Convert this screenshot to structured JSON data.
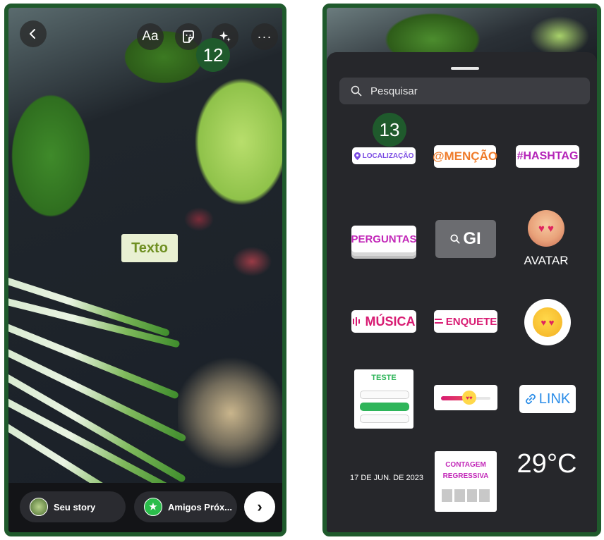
{
  "left_screen": {
    "text_sticker": "Texto",
    "toolbar": {
      "text_tool_label": "Aa",
      "more_label": "···"
    },
    "step_badge": "12",
    "bottom_bar": {
      "your_story_label": "Seu story",
      "close_friends_label": "Amigos Próx...",
      "next_label": "›"
    }
  },
  "right_screen": {
    "step_badge": "13",
    "search": {
      "placeholder": "Pesquisar"
    },
    "stickers": {
      "location": "LOCALIZAÇÃO",
      "mention": "@MENÇÃO",
      "hashtag": "#HASHTAG",
      "questions": "PERGUNTAS",
      "gif": "GI",
      "avatar": "AVATAR",
      "music": "MÚSICA",
      "poll": "ENQUETE",
      "quiz": "TESTE",
      "link": "LINK",
      "date": "17 DE JUN. DE 2023",
      "countdown": "CONTAGEM\nREGRESSIVA",
      "temperature": "29°C"
    },
    "quiz_selected_index": 1
  },
  "colors": {
    "frame_border": "#1f5a2c",
    "badge": "#1f5a2c",
    "tray": "#26272b"
  },
  "icons": [
    "back-icon",
    "sticker-icon",
    "sparkles-icon",
    "search-icon",
    "location-pin-icon",
    "link-icon",
    "chevron-right-icon",
    "star-icon"
  ]
}
